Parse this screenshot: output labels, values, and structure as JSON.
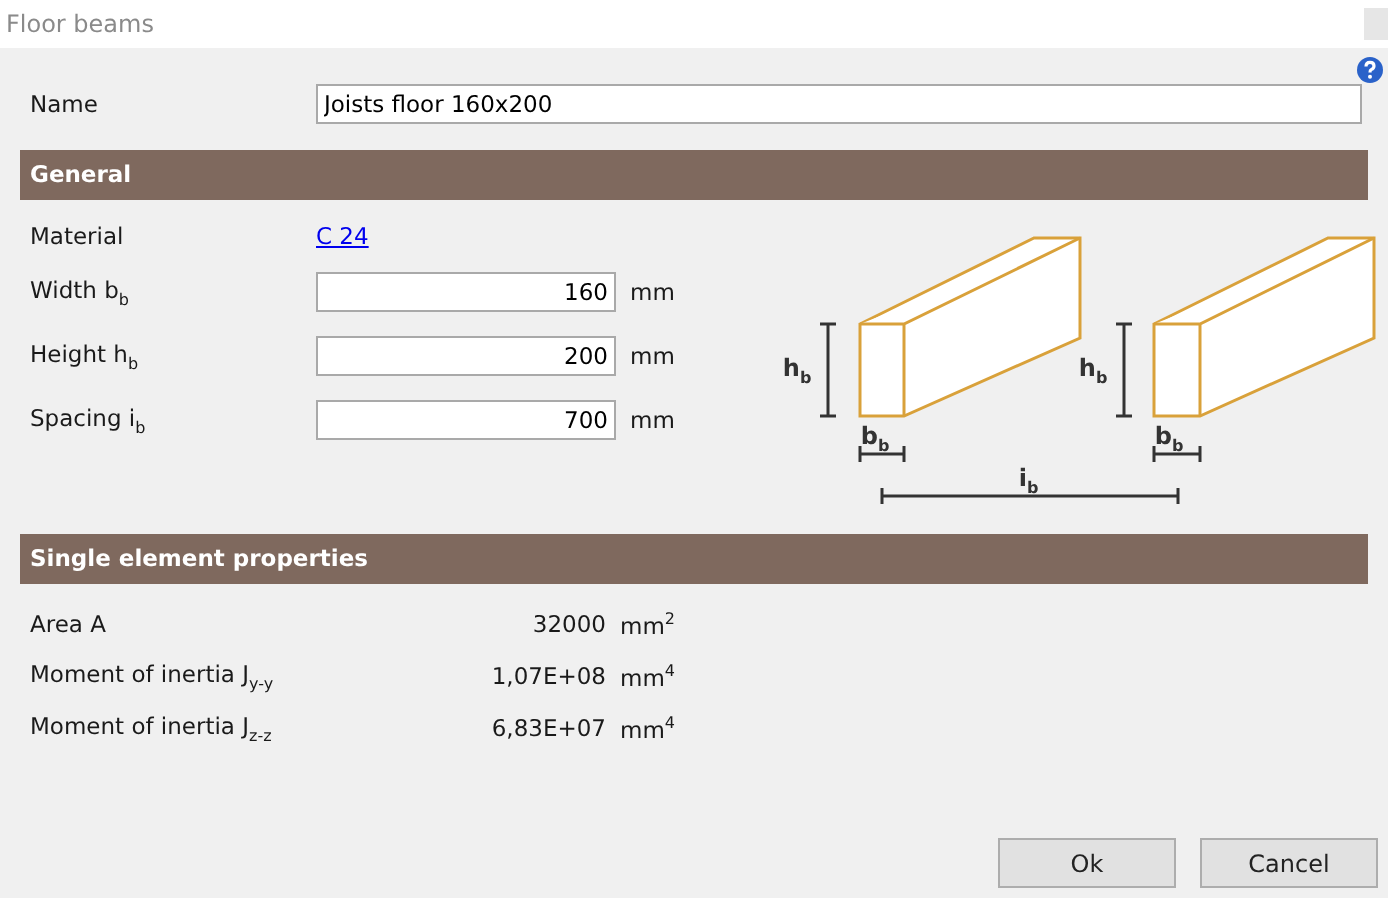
{
  "window": {
    "title": "Floor beams"
  },
  "name_field": {
    "label": "Name",
    "value": "Joists floor 160x200"
  },
  "sections": [
    {
      "kind": "inputs",
      "title": "General",
      "material": {
        "label": "Material",
        "value": "C 24"
      },
      "fields": [
        {
          "label": "Width b$_{b}$",
          "value": "160",
          "unit": "mm"
        },
        {
          "label": "Height h$_{b}$",
          "value": "200",
          "unit": "mm"
        },
        {
          "label": "Spacing i$_{b}$",
          "value": "700",
          "unit": "mm"
        }
      ],
      "diagram_labels": [
        "h$_{b}$",
        "b$_{b}$",
        "h$_{b}$",
        "b$_{b}$",
        "i$_{b}$"
      ]
    },
    {
      "kind": "results",
      "title": "Single element properties",
      "rows": [
        {
          "label": "Area A",
          "value": "32000",
          "unit": "mm$^{2}$"
        },
        {
          "label": "Moment of inertia J$_{y-y}$",
          "value": "1,07E+08",
          "unit": "mm$^{4}$"
        },
        {
          "label": "Moment of inertia J$_{z-z}$",
          "value": "6,83E+07",
          "unit": "mm$^{4}$"
        }
      ]
    }
  ],
  "buttons": [
    "Ok",
    "Cancel"
  ]
}
